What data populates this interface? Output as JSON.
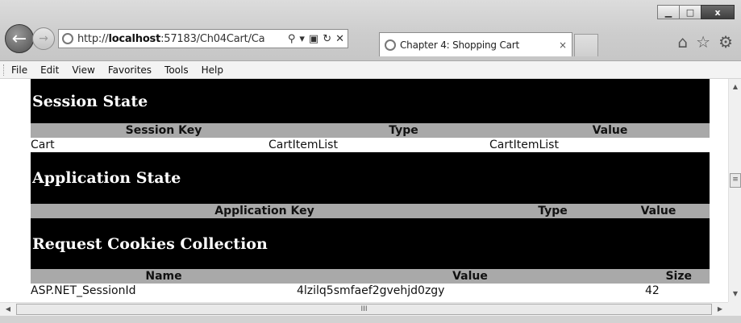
{
  "window": {
    "minimize_label": "▁",
    "maximize_label": "□",
    "close_label": "x"
  },
  "address_bar": {
    "url_prefix": "http://",
    "url_host": "localhost",
    "url_rest": ":57183/Ch04Cart/Ca"
  },
  "tab": {
    "title": "Chapter 4: Shopping Cart",
    "close_label": "×"
  },
  "menu": {
    "items": [
      "File",
      "Edit",
      "View",
      "Favorites",
      "Tools",
      "Help"
    ]
  },
  "sections": {
    "session": {
      "title": "Session State",
      "headers": [
        "Session Key",
        "Type",
        "Value"
      ],
      "rows": [
        [
          "Cart",
          "CartItemList",
          "CartItemList"
        ]
      ]
    },
    "application": {
      "title": "Application State",
      "headers": [
        "Application Key",
        "Type",
        "Value"
      ]
    },
    "cookies": {
      "title": "Request Cookies Collection",
      "headers": [
        "Name",
        "Value",
        "Size"
      ],
      "rows": [
        [
          "ASP.NET_SessionId",
          "4lzilq5smfaef2gvehjd0zgy",
          "42"
        ]
      ]
    }
  },
  "scrollbar": {
    "h_thumb_grip": "III",
    "v_thumb_grip": "≡"
  }
}
